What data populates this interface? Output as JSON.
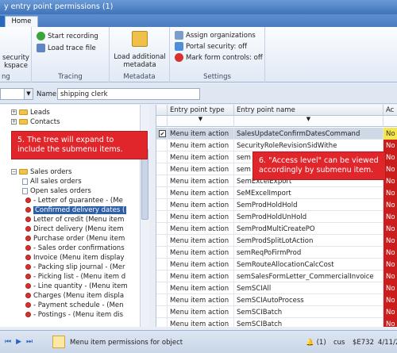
{
  "window": {
    "title": "y entry point permissions (1)"
  },
  "tabs": {
    "home": "Home"
  },
  "ribbon": {
    "security_btn_line1": "security",
    "security_btn_line2": "kspace",
    "security_group_label": "ng",
    "tracing": {
      "start": "Start recording",
      "load": "Load trace file",
      "label": "Tracing"
    },
    "metadata": {
      "line1": "Load additional",
      "line2": "metadata",
      "label": "Metadata"
    },
    "settings": {
      "assign": "Assign organizations",
      "portal": "Portal security: off",
      "mark": "Mark form controls: off",
      "label": "Settings"
    }
  },
  "filter": {
    "name_label": "Name:",
    "name_value": "shipping clerk"
  },
  "tree": {
    "items": [
      {
        "label": "Leads",
        "kind": "folder"
      },
      {
        "label": "Contacts",
        "kind": "folder"
      },
      {
        "label": "Sales orders",
        "kind": "folder"
      },
      {
        "label": "All sales orders",
        "kind": "leaf"
      },
      {
        "label": "Open sales orders",
        "kind": "leaf"
      },
      {
        "label": "- Letter of guarantee - (Me",
        "kind": "item"
      },
      {
        "label": "Confirmed delivery dates (",
        "kind": "item"
      },
      {
        "label": "Letter of credit (Menu item",
        "kind": "item"
      },
      {
        "label": "Direct delivery (Menu item",
        "kind": "item"
      },
      {
        "label": "Purchase order (Menu item",
        "kind": "item"
      },
      {
        "label": "- Sales order confirmations",
        "kind": "item"
      },
      {
        "label": "Invoice (Menu item display",
        "kind": "item"
      },
      {
        "label": "- Packing slip journal - (Mer",
        "kind": "item"
      },
      {
        "label": "- Picking list - (Menu item d",
        "kind": "item"
      },
      {
        "label": "- Line quantity - (Menu item",
        "kind": "item"
      },
      {
        "label": "Charges (Menu item displa",
        "kind": "item"
      },
      {
        "label": "- Payment schedule - (Men",
        "kind": "item"
      },
      {
        "label": "- Postings - (Menu item dis",
        "kind": "item"
      }
    ]
  },
  "grid": {
    "columns": [
      "Entry point type",
      "Entry point name",
      "Ac"
    ],
    "rows": [
      {
        "type": "Menu item action",
        "name": "SalesUpdateConfirmDatesCommand",
        "access": "No"
      },
      {
        "type": "Menu item action",
        "name": "SecurityRoleRevisionSidWithe",
        "access": "No"
      },
      {
        "type": "Menu item action",
        "name": "sem",
        "access": "No"
      },
      {
        "type": "Menu item action",
        "name": "sem",
        "access": "No"
      },
      {
        "type": "Menu item action",
        "name": "SemExcelExport",
        "access": "No"
      },
      {
        "type": "Menu item action",
        "name": "SeMExcelImport",
        "access": "No"
      },
      {
        "type": "Menu item action",
        "name": "SemProdHoldHold",
        "access": "No"
      },
      {
        "type": "Menu item action",
        "name": "SemProdHoldUnHold",
        "access": "No"
      },
      {
        "type": "Menu item action",
        "name": "SemProdMultiCreatePO",
        "access": "No"
      },
      {
        "type": "Menu item action",
        "name": "SemProdSplitLotAction",
        "access": "No"
      },
      {
        "type": "Menu item action",
        "name": "semReqPoFirmProd",
        "access": "No"
      },
      {
        "type": "Menu item action",
        "name": "SemRouteAllocationCalcCost",
        "access": "No"
      },
      {
        "type": "Menu item action",
        "name": "semSalesFormLetter_CommercialInvoice",
        "access": "No"
      },
      {
        "type": "Menu item action",
        "name": "SemSCIAll",
        "access": "No"
      },
      {
        "type": "Menu item action",
        "name": "SemSCIAutoProcess",
        "access": "No"
      },
      {
        "type": "Menu item action",
        "name": "SemSCIBatch",
        "access": "No"
      },
      {
        "type": "Menu item action",
        "name": "SemSCIBatch",
        "access": "No"
      }
    ]
  },
  "callouts": {
    "tree": "5. The tree will expand to include the submenu items.",
    "access": "6. \"Access level\" can be viewed accordingly by submenu item."
  },
  "statusbar": {
    "message": "Menu item permissions for object",
    "alerts": "(1)",
    "company": "cus",
    "currency": "$E732",
    "date": "4/11/2"
  },
  "colors": {
    "callout": "#e0262b",
    "access_no": "#cc1d1d",
    "selection": "#2e5fa8"
  }
}
